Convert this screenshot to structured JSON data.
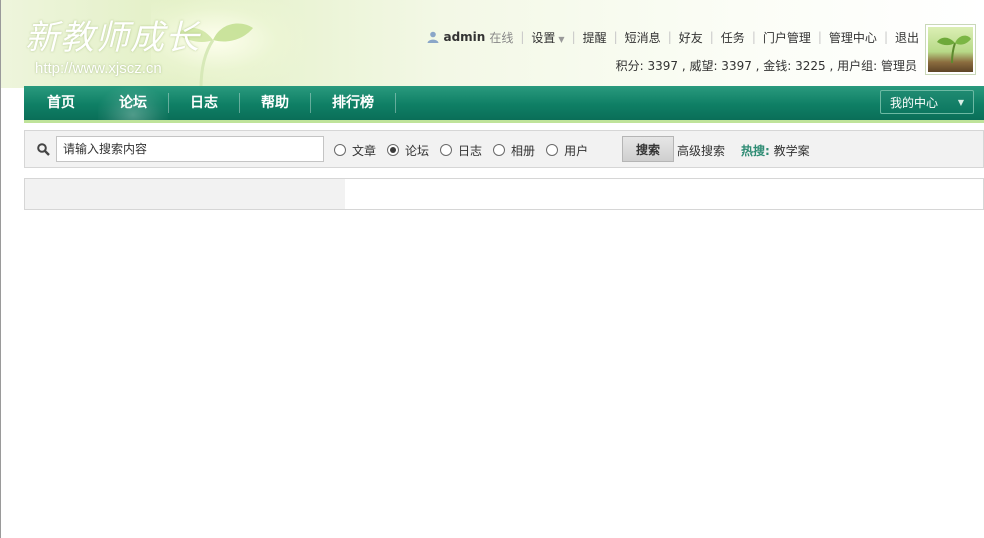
{
  "site": {
    "logo_title": "新教师成长",
    "logo_url": "http://www.xjscz.cn"
  },
  "user": {
    "username": "admin",
    "status": "在线",
    "menu": [
      "设置",
      "提醒",
      "短消息",
      "好友",
      "任务",
      "门户管理",
      "管理中心",
      "退出"
    ],
    "stats": "积分: 3397 , 威望: 3397 , 金钱: 3225 , 用户组: 管理员"
  },
  "nav": {
    "items": [
      "首页",
      "论坛",
      "日志",
      "帮助",
      "排行榜"
    ],
    "active": "论坛",
    "my_center": "我的中心"
  },
  "search": {
    "placeholder": "请输入搜索内容",
    "options": [
      "文章",
      "论坛",
      "日志",
      "相册",
      "用户"
    ],
    "selected": "论坛",
    "button": "搜索",
    "advanced": "高级搜索",
    "hot_label": "热搜:",
    "hot_keyword": "教学案"
  },
  "colors": {
    "nav_bg": "#0f7f65",
    "nav_border": "#bfe39a",
    "hot_label": "#2f8c74"
  },
  "icons": {
    "user": "user-icon",
    "search": "magnifier-icon",
    "dropdown": "caret-down-icon"
  }
}
